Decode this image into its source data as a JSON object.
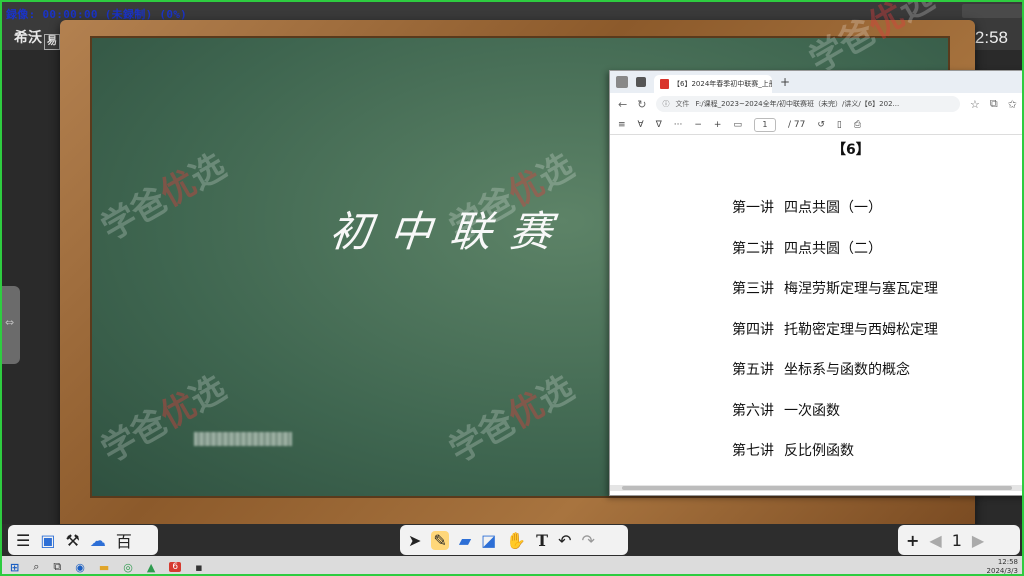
{
  "recording": {
    "label": "録像: 00:00:00 (未録制) (0%)"
  },
  "brand": {
    "name": "希沃",
    "box": "易"
  },
  "clock": {
    "time": "12:58"
  },
  "board": {
    "handwriting": "初中联赛"
  },
  "watermark": {
    "prefix": "学爸",
    "red": "优",
    "suffix": "选"
  },
  "pdf": {
    "tab_title": "【6】2024年春季初中联赛_上册",
    "address_label": "文件",
    "address": "F:/课程_2023~2024全年/初中联赛班（未完）/讲义/【6】202...",
    "page_current": "1",
    "page_total": "/ 77",
    "doc_title": "【6】",
    "toc": [
      {
        "num": "第一讲",
        "title": "四点共圆（一）"
      },
      {
        "num": "第二讲",
        "title": "四点共圆（二）"
      },
      {
        "num": "第三讲",
        "title": "梅涅劳斯定理与塞瓦定理"
      },
      {
        "num": "第四讲",
        "title": "托勒密定理与西姆松定理"
      },
      {
        "num": "第五讲",
        "title": "坐标系与函数的概念"
      },
      {
        "num": "第六讲",
        "title": "一次函数"
      },
      {
        "num": "第七讲",
        "title": "反比例函数"
      }
    ]
  },
  "bottom": {
    "text_tool": "T",
    "add": "+",
    "page_num": "1"
  },
  "taskbar": {
    "pinned_badge": "6",
    "tray_time": "12:58",
    "tray_date": "2024/3/3"
  }
}
